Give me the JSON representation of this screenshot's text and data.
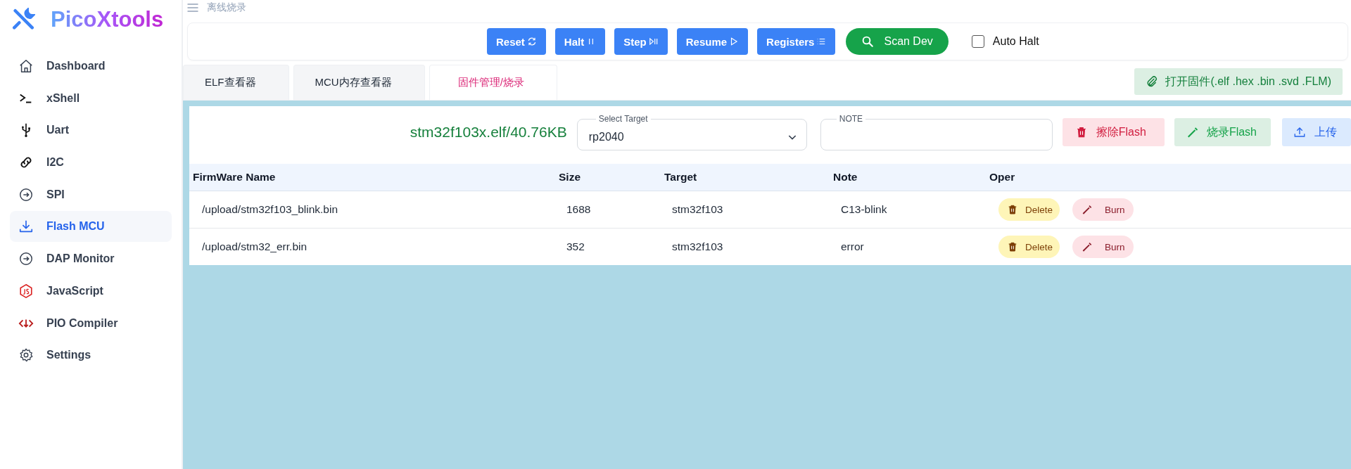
{
  "app": {
    "title": "PicoXtools"
  },
  "sidebar": {
    "items": [
      {
        "label": "Dashboard",
        "selected": false
      },
      {
        "label": "xShell",
        "selected": false
      },
      {
        "label": "Uart",
        "selected": false
      },
      {
        "label": "I2C",
        "selected": false
      },
      {
        "label": "SPI",
        "selected": false
      },
      {
        "label": "Flash MCU",
        "selected": true
      },
      {
        "label": "DAP Monitor",
        "selected": false
      },
      {
        "label": "JavaScript",
        "selected": false
      },
      {
        "label": "PIO Compiler",
        "selected": false
      },
      {
        "label": "Settings",
        "selected": false
      }
    ]
  },
  "breadcrumb": "离线烧录",
  "toolbar": {
    "buttons": [
      {
        "label": "Reset",
        "kind": "primary"
      },
      {
        "label": "Halt",
        "kind": "primary"
      },
      {
        "label": "Step",
        "kind": "primary"
      },
      {
        "label": "Resume",
        "kind": "primary"
      },
      {
        "label": "Registers",
        "kind": "primary"
      },
      {
        "label": "Scan Dev",
        "kind": "success"
      }
    ],
    "auto_halt": {
      "label": "Auto Halt",
      "checked": false
    }
  },
  "tabs": [
    {
      "label": "ELF查看器",
      "selected": false
    },
    {
      "label": "MCU内存查看器",
      "selected": false
    },
    {
      "label": "固件管理/烧录",
      "selected": true
    }
  ],
  "open_firmware_button": "打开固件(.elf .hex .bin .svd .FLM)",
  "panel": {
    "file_info": "stm32f103x.elf/40.76KB",
    "select_target": {
      "label": "Select Target",
      "value": "rp2040"
    },
    "note_field": {
      "label": "NOTE"
    },
    "buttons": [
      {
        "label": "擦除Flash",
        "kind": "danger"
      },
      {
        "label": "烧录Flash",
        "kind": "success"
      },
      {
        "label": "上传",
        "kind": "info"
      }
    ]
  },
  "table": {
    "columns": [
      "FirmWare Name",
      "Size",
      "Target",
      "Note",
      "Oper"
    ],
    "rows": [
      {
        "name": "/upload/stm32f103_blink.bin",
        "size": "1688",
        "target": "stm32f103",
        "note": "C13-blink",
        "actions": [
          "Delete",
          "Burn"
        ]
      },
      {
        "name": "/upload/stm32_err.bin",
        "size": "352",
        "target": "stm32f103",
        "note": "error",
        "actions": [
          "Delete",
          "Burn"
        ]
      }
    ]
  }
}
